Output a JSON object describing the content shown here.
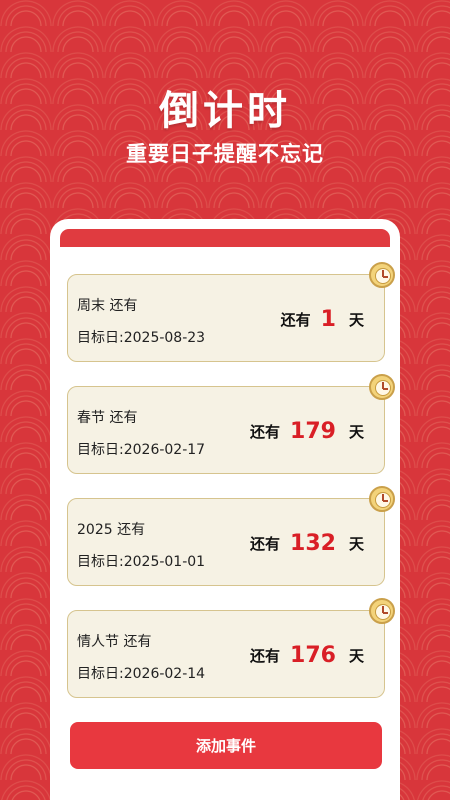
{
  "header": {
    "title": "倒计时",
    "subtitle": "重要日子提醒不忘记"
  },
  "events": [
    {
      "name": "周末 还有",
      "date": "目标日:2025-08-23",
      "prefix": "还有",
      "days": "1",
      "unit": "天"
    },
    {
      "name": "春节 还有",
      "date": "目标日:2026-02-17",
      "prefix": "还有",
      "days": "179",
      "unit": "天"
    },
    {
      "name": "2025 还有",
      "date": "目标日:2025-01-01",
      "prefix": "还有",
      "days": "132",
      "unit": "天"
    },
    {
      "name": "情人节 还有",
      "date": "目标日:2026-02-14",
      "prefix": "还有",
      "days": "176",
      "unit": "天"
    }
  ],
  "icons": {
    "card": "clock-icon"
  },
  "add_button": {
    "label": "添加事件"
  },
  "colors": {
    "accent": "#e8383f",
    "days": "#d91f26",
    "card_bg": "#f6f2e4"
  }
}
